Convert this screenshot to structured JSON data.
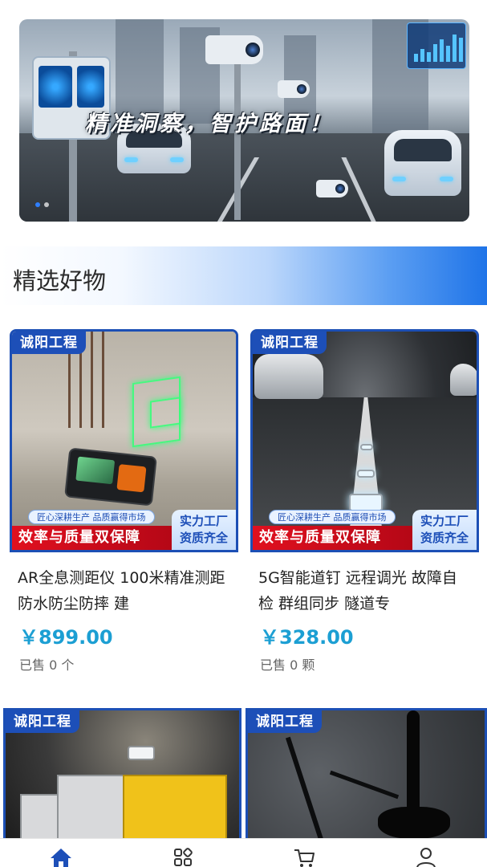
{
  "banner": {
    "slogan": "精准洞察，智护路面！",
    "page_indicator": {
      "count": 2,
      "active_index": 0
    }
  },
  "section": {
    "title": "精选好物"
  },
  "products": [
    {
      "brand": "诚阳工程",
      "craft_tag": "匠心深耕生产  品质赢得市场",
      "guarantee": "效率与质量双保障",
      "factory_line1": "实力工厂",
      "factory_line2": "资质齐全",
      "name": "AR全息测距仪 100米精准测距 防水防尘防摔 建",
      "price": "￥899.00",
      "sold": "已售 0 个"
    },
    {
      "brand": "诚阳工程",
      "craft_tag": "匠心深耕生产  品质赢得市场",
      "guarantee": "效率与质量双保障",
      "factory_line1": "实力工厂",
      "factory_line2": "资质齐全",
      "name": "5G智能道钉 远程调光 故障自检 群组同步 隧道专",
      "price": "￥328.00",
      "sold": "已售 0 颗"
    },
    {
      "brand": "诚阳工程"
    },
    {
      "brand": "诚阳工程"
    }
  ],
  "nav": {
    "items": [
      {
        "icon": "home-icon",
        "active": true
      },
      {
        "icon": "category-icon",
        "active": false
      },
      {
        "icon": "cart-icon",
        "active": false
      },
      {
        "icon": "user-icon",
        "active": false
      }
    ],
    "active_color": "#1d4fb8",
    "inactive_color": "#333333"
  },
  "colors": {
    "brand_blue": "#1d4fb8",
    "price": "#1c9fd3",
    "guarantee_red": "#d90d1c"
  }
}
